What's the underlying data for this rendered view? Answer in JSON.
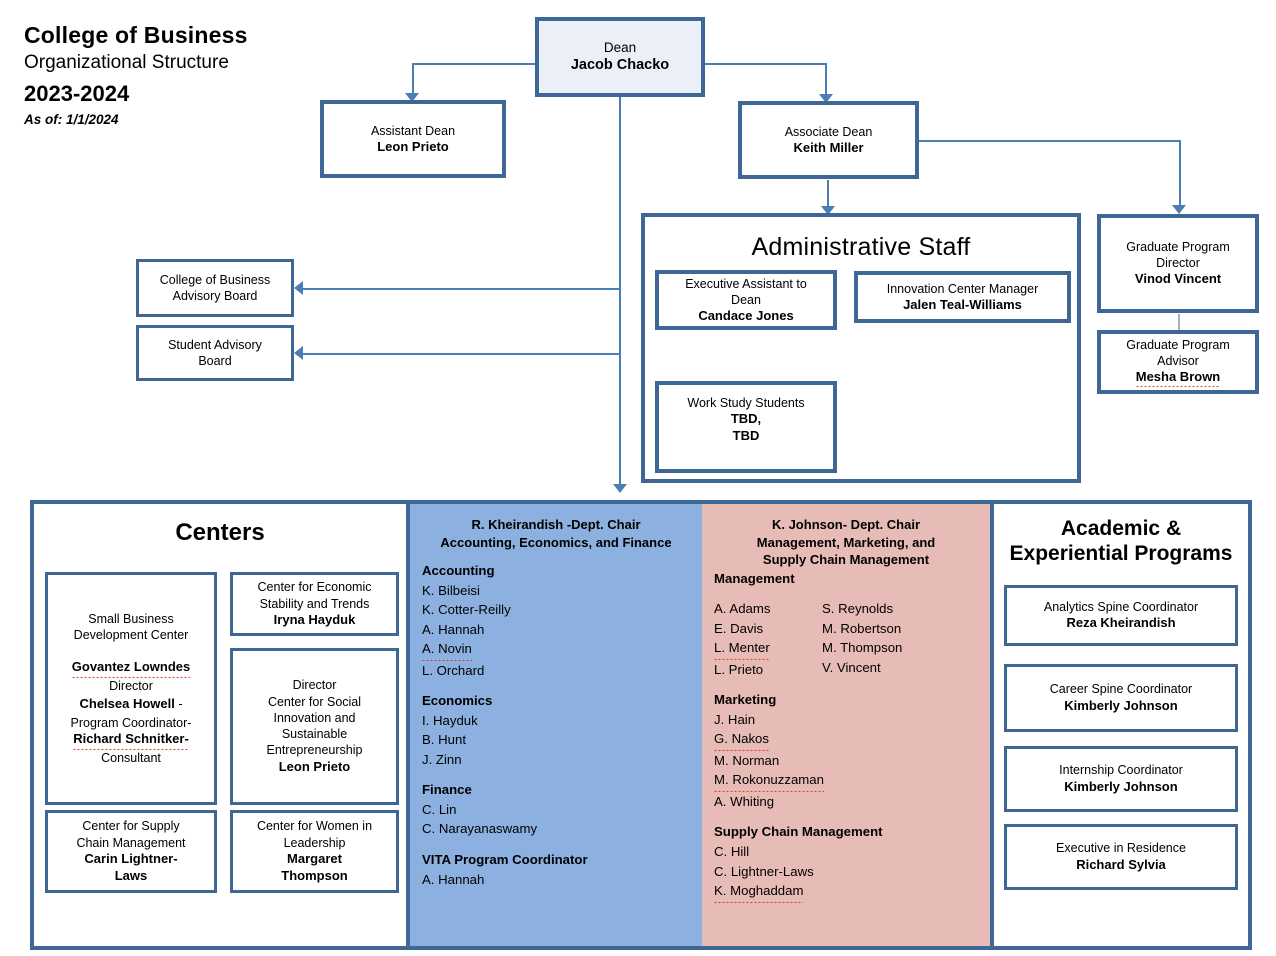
{
  "title": {
    "line1": "College of Business",
    "line2": "Organizational  Structure",
    "line3": "2023-2024",
    "line4": "As of: 1/1/2024"
  },
  "colors": {
    "border": "#3E6796",
    "connector": "#4A7EB5",
    "dean_fill": "#EBF0F8",
    "dept1_fill": "#8CB1E0",
    "dept2_fill": "#E8BCB6"
  },
  "leadership": {
    "dean": {
      "role": "Dean",
      "person": "Jacob Chacko"
    },
    "assistant_dean": {
      "role": "Assistant Dean",
      "person": "Leon Prieto"
    },
    "associate_dean": {
      "role": "Associate Dean",
      "person": "Keith Miller"
    },
    "grad_director": {
      "role": "Graduate Program\nDirector",
      "role_l1": "Graduate Program",
      "role_l2": "Director",
      "person": "Vinod Vincent"
    },
    "grad_advisor": {
      "role_l1": "Graduate Program",
      "role_l2": "Advisor",
      "person": "Mesha Brown"
    }
  },
  "advisory_boards": [
    {
      "line1": "College of Business",
      "line2": "Advisory Board"
    },
    {
      "line1": "Student Advisory",
      "line2": "Board"
    }
  ],
  "admin_staff": {
    "title": "Administrative Staff",
    "exec_assistant": {
      "role_l1": "Executive Assistant to",
      "role_l2": "Dean",
      "person": "Candace Jones"
    },
    "innovation_manager": {
      "role": "Innovation Center Manager",
      "person": "Jalen Teal-Williams"
    },
    "work_study": {
      "role": "Work Study Students",
      "person_l1": "TBD,",
      "person_l2": "TBD"
    }
  },
  "centers": {
    "heading": "Centers",
    "sbdc": {
      "name_l1": "Small Business",
      "name_l2": "Development Center",
      "p1": "Govantez Lowndes",
      "p1_title": "Director",
      "p2": "Chelsea Howell",
      "p2_dash": " -",
      "p2_title": "Program Coordinator-",
      "p3": "Richard Schnitker-",
      "p3_title": "Consultant"
    },
    "economic_stability": {
      "name_l1": "Center for Economic",
      "name_l2": "Stability and Trends",
      "person": "Iryna Hayduk"
    },
    "social_innovation": {
      "l1": "Director",
      "l2": "Center for Social",
      "l3": "Innovation and",
      "l4": "Sustainable",
      "l5": "Entrepreneurship",
      "person": "Leon Prieto"
    },
    "supply_chain": {
      "name_l1": "Center for Supply",
      "name_l2": "Chain Management",
      "person_l1": "Carin Lightner-",
      "person_l2": "Laws"
    },
    "women_leadership": {
      "name_l1": "Center for Women in",
      "name_l2": "Leadership",
      "person_l1": "Margaret",
      "person_l2": "Thompson"
    }
  },
  "departments": [
    {
      "chair_l1": "R. Kheirandish -Dept. Chair",
      "chair_l2": "Accounting, Economics, and Finance",
      "groups": [
        {
          "name": "Accounting",
          "members": [
            "K. Bilbeisi",
            "K. Cotter-Reilly",
            "A. Hannah",
            "A. Novin",
            "L. Orchard"
          ]
        },
        {
          "name": "Economics",
          "members": [
            "I. Hayduk",
            "B. Hunt",
            "J. Zinn"
          ]
        },
        {
          "name": "Finance",
          "members": [
            "C. Lin",
            "C. Narayanaswamy"
          ]
        },
        {
          "name": "VITA Program  Coordinator",
          "members": [
            "A. Hannah"
          ]
        }
      ]
    },
    {
      "chair_l1": "K. Johnson- Dept. Chair",
      "chair_l2": "Management, Marketing, and",
      "chair_l3": "Supply Chain Management",
      "management_label": "Management",
      "management_col1": [
        "A. Adams",
        "E. Davis",
        "L. Menter",
        "L. Prieto"
      ],
      "management_col2": [
        "S. Reynolds",
        "M. Robertson",
        "M. Thompson",
        "V. Vincent"
      ],
      "groups": [
        {
          "name": "Marketing",
          "members": [
            "J. Hain",
            "G. Nakos",
            "M. Norman",
            "M. Rokonuzzaman",
            "A. Whiting"
          ]
        },
        {
          "name": "Supply Chain Management",
          "members": [
            "C. Hill",
            "C. Lightner-Laws",
            "K. Moghaddam"
          ]
        }
      ]
    }
  ],
  "academic_programs": {
    "heading_l1": "Academic &",
    "heading_l2": "Experiential Programs",
    "items": [
      {
        "role": "Analytics Spine Coordinator",
        "person": "Reza Kheirandish"
      },
      {
        "role": "Career Spine Coordinator",
        "person": "Kimberly Johnson"
      },
      {
        "role": "Internship Coordinator",
        "person": "Kimberly Johnson"
      },
      {
        "role": "Executive in Residence",
        "person": "Richard Sylvia"
      }
    ]
  }
}
